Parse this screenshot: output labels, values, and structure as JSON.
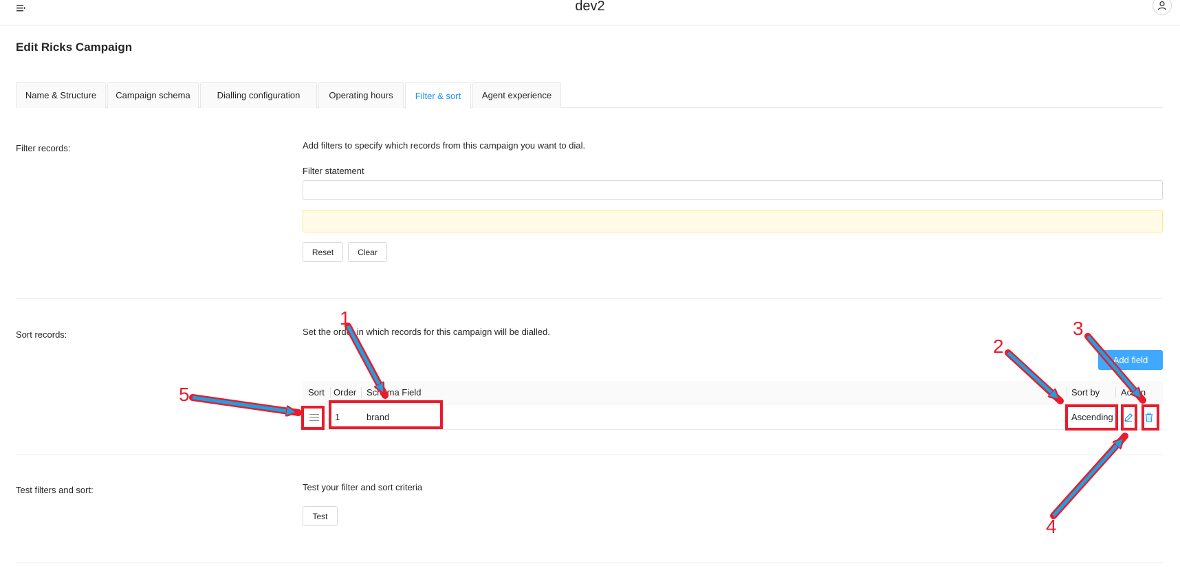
{
  "header": {
    "menu_icon": "hamburger-menu-icon",
    "title": "dev2",
    "user_icon": "user-profile-icon"
  },
  "page": {
    "title": "Edit Ricks Campaign"
  },
  "tabs": [
    {
      "label": "Name & Structure",
      "active": false
    },
    {
      "label": "Campaign schema",
      "active": false
    },
    {
      "label": "Dialling configuration",
      "active": false
    },
    {
      "label": "Operating hours",
      "active": false
    },
    {
      "label": "Filter & sort",
      "active": true
    },
    {
      "label": "Agent experience",
      "active": false
    }
  ],
  "filter": {
    "label": "Filter records:",
    "description": "Add filters to specify which records from this campaign you want to dial.",
    "statement_label": "Filter statement",
    "statement_value": "",
    "reset_label": "Reset",
    "clear_label": "Clear"
  },
  "sort": {
    "label": "Sort records:",
    "description": "Set the order in which records for this campaign will be dialled.",
    "add_field_label": "Add field",
    "columns": {
      "sort": "Sort",
      "order": "Order",
      "schema_field": "Schema Field",
      "sort_by": "Sort by",
      "action": "Action"
    },
    "rows": [
      {
        "order": "1",
        "schema_field": "brand",
        "sort_by": "Ascending"
      }
    ]
  },
  "test": {
    "label": "Test filters and sort:",
    "description": "Test your filter and sort criteria",
    "test_label": "Test"
  },
  "annotations": [
    "1",
    "2",
    "3",
    "4",
    "5"
  ],
  "colors": {
    "accent": "#1890ff",
    "primary_button": "#40a9ff",
    "annotation_red": "#e81c2c",
    "annotation_arrow": "#1ba1e2",
    "warning_bg": "#fffbe6"
  }
}
